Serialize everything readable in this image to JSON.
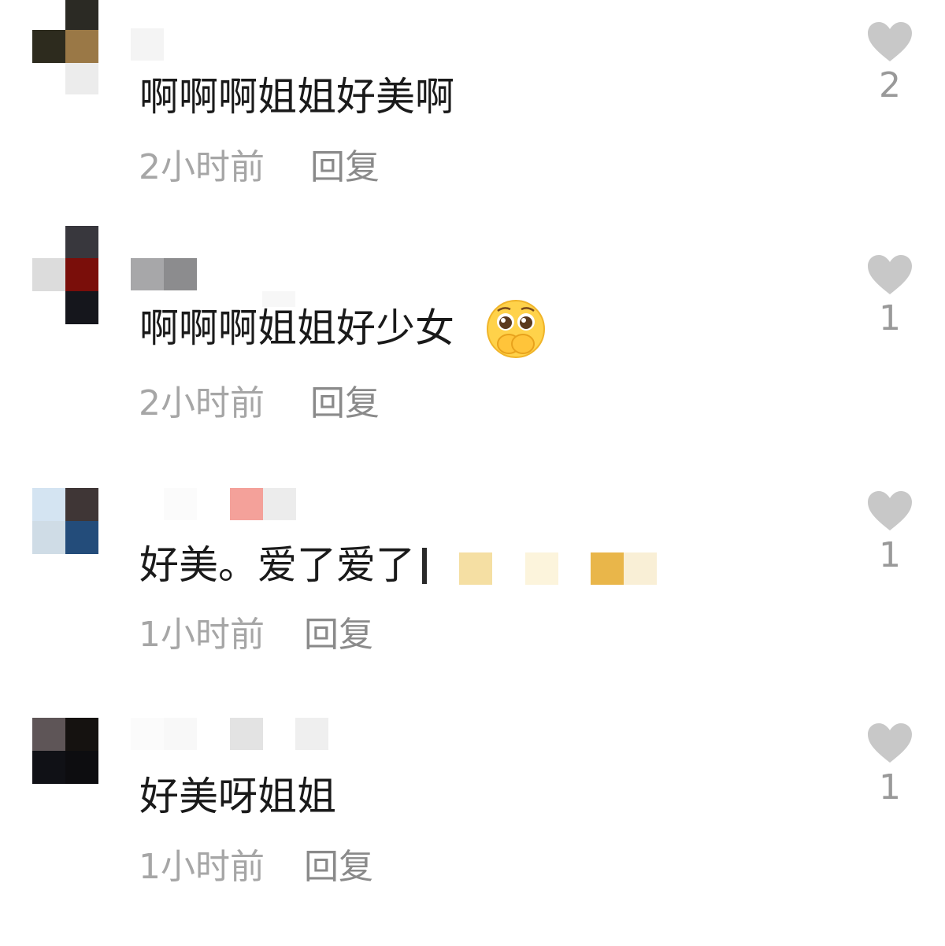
{
  "comments": [
    {
      "text": "啊啊啊姐姐好美啊",
      "time": "2小时前",
      "reply_label": "回复",
      "likes": "2"
    },
    {
      "text": "啊啊啊姐姐好少女",
      "emoji": "pleading-face-emoji",
      "time": "2小时前",
      "reply_label": "回复",
      "likes": "1"
    },
    {
      "text": "好美。爱了爱了",
      "time": "1小时前",
      "reply_label": "回复",
      "likes": "1"
    },
    {
      "text": "好美呀姐姐",
      "time": "1小时前",
      "reply_label": "回复",
      "likes": "1"
    }
  ],
  "colors": {
    "text": "#1a1a1a",
    "meta": "#a6a6a6",
    "reply": "#8a8a8a",
    "heart": "#c8c8c8",
    "like_count": "#999999"
  },
  "icons": {
    "like": "heart-icon",
    "avatar": "pixelated-avatar",
    "username": "pixelated-username"
  }
}
